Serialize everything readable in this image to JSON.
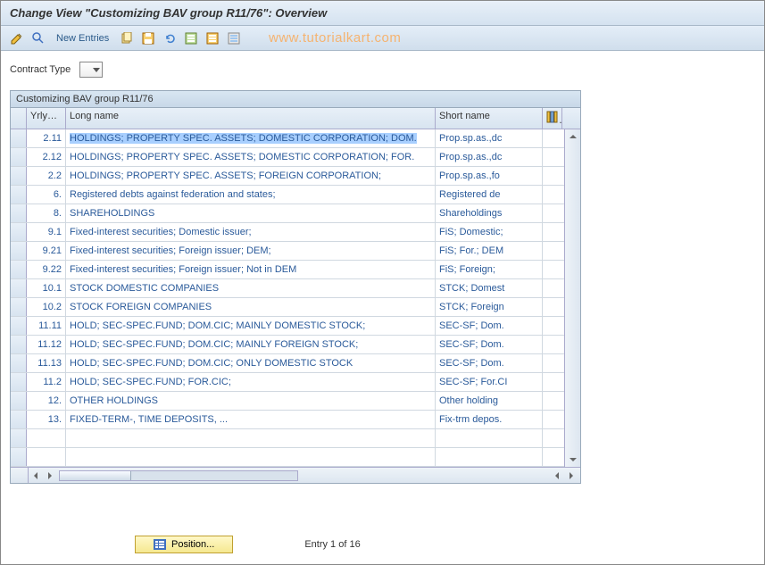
{
  "title": "Change View \"Customizing BAV group R11/76\": Overview",
  "toolbar": {
    "new_entries_label": "New Entries"
  },
  "watermark": "www.tutorialkart.com",
  "contract": {
    "label": "Contract Type"
  },
  "table": {
    "title": "Customizing BAV group R11/76",
    "headers": {
      "col1": "YrlyS...",
      "col2": "Long name",
      "col3": "Short name"
    },
    "rows": [
      {
        "c1": "2.11",
        "c2": "HOLDINGS; PROPERTY SPEC. ASSETS; DOMESTIC CORPORATION; DOM.",
        "c3": "Prop.sp.as.,dc"
      },
      {
        "c1": "2.12",
        "c2": "HOLDINGS; PROPERTY SPEC. ASSETS; DOMESTIC CORPORATION; FOR.",
        "c3": "Prop.sp.as.,dc"
      },
      {
        "c1": "2.2",
        "c2": "HOLDINGS; PROPERTY SPEC. ASSETS; FOREIGN CORPORATION;",
        "c3": "Prop.sp.as.,fo"
      },
      {
        "c1": "6.",
        "c2": "Registered debts against federation and states;",
        "c3": "Registered de"
      },
      {
        "c1": "8.",
        "c2": "SHAREHOLDINGS",
        "c3": "Shareholdings"
      },
      {
        "c1": "9.1",
        "c2": "Fixed-interest securities; Domestic issuer;",
        "c3": "FiS; Domestic;"
      },
      {
        "c1": "9.21",
        "c2": "Fixed-interest securities; Foreign issuer; DEM;",
        "c3": "FiS; For.; DEM"
      },
      {
        "c1": "9.22",
        "c2": "Fixed-interest securities; Foreign issuer; Not in DEM",
        "c3": "FiS; Foreign;"
      },
      {
        "c1": "10.1",
        "c2": "STOCK DOMESTIC COMPANIES",
        "c3": "STCK; Domest"
      },
      {
        "c1": "10.2",
        "c2": "STOCK FOREIGN COMPANIES",
        "c3": "STCK; Foreign"
      },
      {
        "c1": "11.11",
        "c2": "HOLD; SEC-SPEC.FUND; DOM.CIC; MAINLY DOMESTIC STOCK;",
        "c3": "SEC-SF; Dom."
      },
      {
        "c1": "11.12",
        "c2": "HOLD; SEC-SPEC.FUND; DOM.CIC; MAINLY FOREIGN STOCK;",
        "c3": "SEC-SF; Dom."
      },
      {
        "c1": "11.13",
        "c2": "HOLD; SEC-SPEC.FUND; DOM.CIC; ONLY DOMESTIC STOCK",
        "c3": "SEC-SF; Dom."
      },
      {
        "c1": "11.2",
        "c2": "HOLD; SEC-SPEC.FUND; FOR.CIC;",
        "c3": "SEC-SF; For.CI"
      },
      {
        "c1": "12.",
        "c2": "OTHER HOLDINGS",
        "c3": "Other holding"
      },
      {
        "c1": "13.",
        "c2": "FIXED-TERM-, TIME DEPOSITS, ...",
        "c3": "Fix-trm depos."
      }
    ]
  },
  "footer": {
    "position_label": "Position...",
    "entry_text": "Entry 1 of 16"
  }
}
